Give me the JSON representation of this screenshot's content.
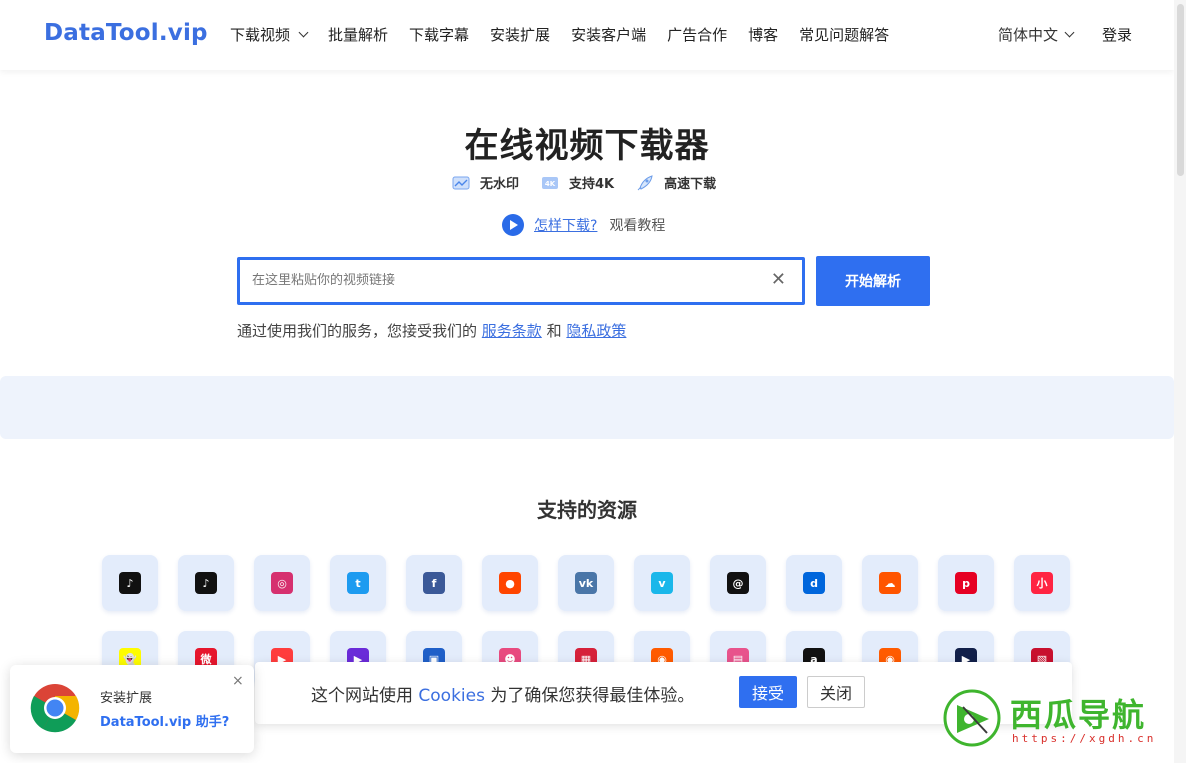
{
  "header": {
    "logo": "DataTool.vip",
    "nav": [
      {
        "label": "下载视频",
        "has_dropdown": true
      },
      {
        "label": "批量解析"
      },
      {
        "label": "下载字幕"
      },
      {
        "label": "安装扩展"
      },
      {
        "label": "安装客户端"
      },
      {
        "label": "广告合作"
      },
      {
        "label": "博客"
      },
      {
        "label": "常见问题解答"
      }
    ],
    "language": "简体中文",
    "login": "登录"
  },
  "hero": {
    "title": "在线视频下载器",
    "features": [
      {
        "icon": "no-watermark-icon",
        "label": "无水印"
      },
      {
        "icon": "4k-icon",
        "label": "支持4K"
      },
      {
        "icon": "rocket-icon",
        "label": "高速下载"
      }
    ],
    "howto_link": "怎样下载?",
    "howto_text": "观看教程",
    "search_placeholder": "在这里粘贴你的视频链接",
    "search_value": "",
    "submit_label": "开始解析",
    "terms_prefix": "通过使用我们的服务，您接受我们的",
    "terms_link": "服务条款",
    "terms_and": "和",
    "privacy_link": "隐私政策"
  },
  "sources": {
    "title": "支持的资源",
    "row1": [
      {
        "name": "tiktok-icon",
        "color": "#111111",
        "glyph": "♪"
      },
      {
        "name": "douyin-icon",
        "color": "#111111",
        "glyph": "♪"
      },
      {
        "name": "instagram-icon",
        "color": "#d6306f",
        "glyph": "◎"
      },
      {
        "name": "twitter-icon",
        "color": "#1d9bf0",
        "glyph": "t"
      },
      {
        "name": "facebook-icon",
        "color": "#3b5998",
        "glyph": "f"
      },
      {
        "name": "reddit-icon",
        "color": "#ff4500",
        "glyph": "●"
      },
      {
        "name": "vk-icon",
        "color": "#4a76a8",
        "glyph": "vk"
      },
      {
        "name": "vimeo-icon",
        "color": "#1ab7ea",
        "glyph": "v"
      },
      {
        "name": "threads-icon",
        "color": "#111111",
        "glyph": "@"
      },
      {
        "name": "dailymotion-icon",
        "color": "#0066dc",
        "glyph": "d"
      },
      {
        "name": "soundcloud-icon",
        "color": "#ff5500",
        "glyph": "☁"
      },
      {
        "name": "pinterest-icon",
        "color": "#e60023",
        "glyph": "p"
      },
      {
        "name": "xiaohongshu-icon",
        "color": "#ff2442",
        "glyph": "小"
      }
    ],
    "row2": [
      {
        "name": "snapchat-icon",
        "color": "#fffc00",
        "glyph": "👻"
      },
      {
        "name": "weibo-icon",
        "color": "#e6162d",
        "glyph": "微"
      },
      {
        "name": "youtube-icon",
        "color": "#ff3d3d",
        "glyph": "▶"
      },
      {
        "name": "video-app-icon",
        "color": "#6a2bd8",
        "glyph": "▶"
      },
      {
        "name": "blue-app-icon",
        "color": "#1f5fc8",
        "glyph": "▣"
      },
      {
        "name": "character-app-icon",
        "color": "#e84a7f",
        "glyph": "☻"
      },
      {
        "name": "red-app-icon",
        "color": "#d6213a",
        "glyph": "▦"
      },
      {
        "name": "kuaishou-icon",
        "color": "#ff5b00",
        "glyph": "◉"
      },
      {
        "name": "pink-app-icon",
        "color": "#e8538c",
        "glyph": "▤"
      },
      {
        "name": "amazon-icon",
        "color": "#111111",
        "glyph": "a"
      },
      {
        "name": "kuaishou-alt-icon",
        "color": "#ff5b00",
        "glyph": "◉"
      },
      {
        "name": "play-app-icon",
        "color": "#12204a",
        "glyph": "▶"
      },
      {
        "name": "red-square-app-icon",
        "color": "#c8102e",
        "glyph": "▧"
      }
    ]
  },
  "cookie": {
    "text_before": "这个网站使用",
    "cookies_word": "Cookies",
    "text_after": "为了确保您获得最佳体验。",
    "accept_label": "接受",
    "close_label": "关闭"
  },
  "extension_popup": {
    "line1": "安装扩展",
    "line2": "DataTool.vip 助手?",
    "close": "×"
  },
  "watermark": {
    "name": "西瓜导航",
    "url": "https://xgdh.cn"
  }
}
